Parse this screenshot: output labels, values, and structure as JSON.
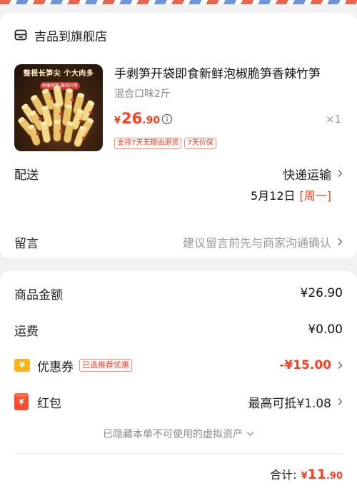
{
  "shop": {
    "name": "吉品到旗舰店"
  },
  "product": {
    "thumb_banner": "整根长笋尖 个大肉多",
    "thumb_badge": "鲜嫩爽脆 酸辣开胃",
    "title": "手剥笋开袋即食新鲜泡椒脆笋香辣竹笋",
    "variant": "混合口味2斤",
    "price_symbol": "¥",
    "price_int": "26",
    "price_dec": ".90",
    "quantity": "×1",
    "tags": [
      "支持7天无理由退货",
      "7天价保"
    ]
  },
  "delivery": {
    "label": "配送",
    "method": "快递运输",
    "date": "5月12日",
    "weekday": "[周一]"
  },
  "memo": {
    "label": "留言",
    "placeholder": "建议留言前先与商家沟通确认"
  },
  "summary": {
    "subtotal_label": "商品金额",
    "subtotal_value": "¥26.90",
    "shipping_label": "运费",
    "shipping_value": "¥0.00",
    "coupon_label": "优惠券",
    "coupon_icon_text": "¥",
    "coupon_tag": "已选推荐优惠",
    "coupon_value": "-¥15.00",
    "redpacket_label": "红包",
    "redpacket_icon_text": "¥",
    "redpacket_value": "最高可抵¥1.08",
    "hidden_assets": "已隐藏本单不可使用的虚拟资产",
    "total_label": "合计:",
    "total_symbol": "¥",
    "total_int": "11",
    "total_dec": ".90"
  },
  "colors": {
    "accent": "#ff3d1f",
    "background": "#f2f2f2",
    "coupon_icon": "#ffb21a",
    "redpacket_icon": "#ff4b2b"
  }
}
